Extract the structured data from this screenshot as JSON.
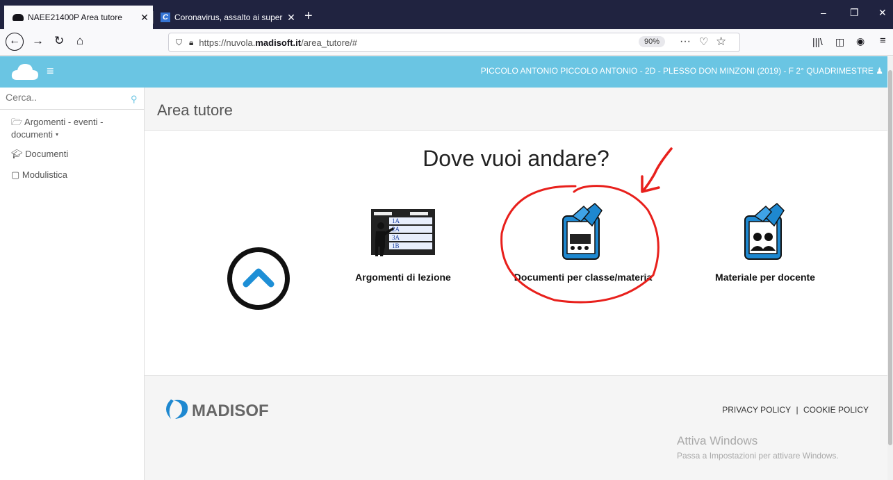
{
  "browser": {
    "tabs": [
      {
        "title": "NAEE21400P Area tutore",
        "active": true,
        "icon": "cloud-icon"
      },
      {
        "title": "Coronavirus, assalto ai superm",
        "active": false,
        "icon": "c-icon"
      }
    ],
    "url": {
      "prefix": "https://nuvola.",
      "domain": "madisoft.it",
      "path": "/area_tutore/#"
    },
    "zoom": "90%"
  },
  "header": {
    "user": "PICCOLO ANTONIO  PICCOLO ANTONIO - 2D - PLESSO DON MINZONI (2019) - F  2° QUADRIMESTRE"
  },
  "sidebar": {
    "search_placeholder": "Cerca..",
    "items": [
      {
        "label": "Argomenti - eventi - documenti ▾",
        "icon": "folder-open-icon"
      },
      {
        "label": "Documenti",
        "icon": "graduation-cap-icon"
      },
      {
        "label": "Modulistica",
        "icon": "briefcase-icon"
      }
    ]
  },
  "main": {
    "title": "Area tutore",
    "question": "Dove vuoi andare?",
    "choices": [
      {
        "label": "Argomenti di lezione",
        "icon": "teacher-blackboard-icon"
      },
      {
        "label": "Documenti per classe/materia",
        "icon": "class-documents-icon"
      },
      {
        "label": "Materiale per docente",
        "icon": "teacher-material-icon"
      }
    ]
  },
  "footer": {
    "brand": "MADISOFT",
    "privacy": "PRIVACY POLICY",
    "separator": "|",
    "cookie": "COOKIE POLICY"
  },
  "watermark": {
    "line1": "Attiva Windows",
    "line2": "Passa a Impostazioni per attivare Windows."
  },
  "colors": {
    "header": "#6ac5e3",
    "annotation": "#e8201c",
    "tabbar": "#202340"
  }
}
